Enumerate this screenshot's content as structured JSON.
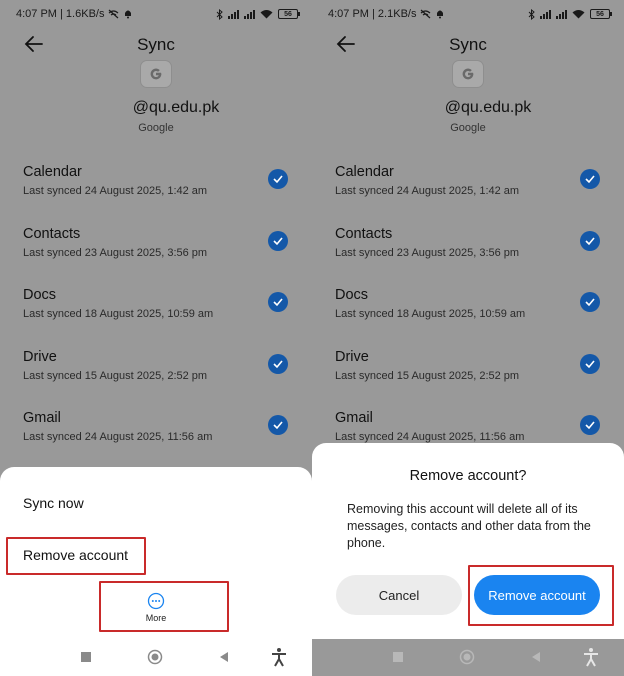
{
  "colors": {
    "overlay_gray": "#999999",
    "sheet_white": "#ffffff",
    "check_blue": "#1458a8",
    "primary_button": "#1a84f0",
    "cancel_button": "#ececec",
    "highlight_red": "#c92a2a"
  },
  "left": {
    "status": {
      "time_speed": "4:07 PM | 1.6KB/s",
      "battery": "56"
    },
    "title": "Sync",
    "account": {
      "email": "@qu.edu.pk",
      "type": "Google",
      "icon": "google-icon"
    },
    "sync_items": [
      {
        "name": "Calendar",
        "meta": "Last synced 24 August 2025, 1:42 am"
      },
      {
        "name": "Contacts",
        "meta": "Last synced 23 August 2025, 3:56 pm"
      },
      {
        "name": "Docs",
        "meta": "Last synced 18 August 2025, 10:59 am"
      },
      {
        "name": "Drive",
        "meta": "Last synced 15 August 2025, 2:52 pm"
      },
      {
        "name": "Gmail",
        "meta": "Last synced 24 August 2025, 11:56 am"
      }
    ],
    "sheet": {
      "sync_now": "Sync now",
      "remove_account": "Remove account",
      "more": "More"
    }
  },
  "right": {
    "status": {
      "time_speed": "4:07 PM | 2.1KB/s",
      "battery": "56"
    },
    "title": "Sync",
    "account": {
      "email": "@qu.edu.pk",
      "type": "Google",
      "icon": "google-icon"
    },
    "sync_items": [
      {
        "name": "Calendar",
        "meta": "Last synced 24 August 2025, 1:42 am"
      },
      {
        "name": "Contacts",
        "meta": "Last synced 23 August 2025, 3:56 pm"
      },
      {
        "name": "Docs",
        "meta": "Last synced 18 August 2025, 10:59 am"
      },
      {
        "name": "Drive",
        "meta": "Last synced 15 August 2025, 2:52 pm"
      },
      {
        "name": "Gmail",
        "meta": "Last synced 24 August 2025, 11:56 am"
      }
    ],
    "dialog": {
      "title": "Remove account?",
      "body": "Removing this account will delete all of its messages, contacts and other data from the phone.",
      "cancel": "Cancel",
      "confirm": "Remove account"
    }
  }
}
